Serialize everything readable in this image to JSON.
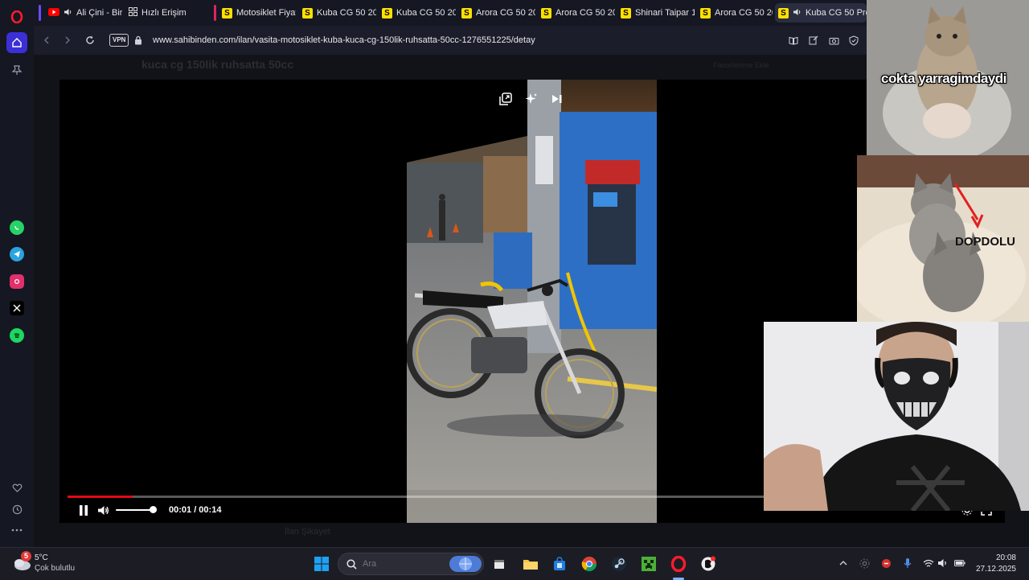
{
  "browser": {
    "tabs": [
      {
        "title": "Ali Çini - Birh",
        "favicon": "youtube-icon",
        "audio": true
      },
      {
        "title": "Hızlı Erişim",
        "favicon": "speed-dial-icon"
      },
      {
        "title": "Motosiklet Fiyatl",
        "favicon": "sahibinden-icon"
      },
      {
        "title": "Kuba CG 50 2024",
        "favicon": "sahibinden-icon"
      },
      {
        "title": "Kuba CG 50 2024",
        "favicon": "sahibinden-icon"
      },
      {
        "title": "Arora CG 50 202",
        "favicon": "sahibinden-icon"
      },
      {
        "title": "Arora CG 50 202",
        "favicon": "sahibinden-icon"
      },
      {
        "title": "Shinari Taipar 10",
        "favicon": "sahibinden-icon"
      },
      {
        "title": "Arora CG 50 202",
        "favicon": "sahibinden-icon"
      },
      {
        "title": "Kuba CG 50 Pro U",
        "favicon": "sahibinden-icon",
        "audio": true,
        "active": true
      }
    ],
    "url": "www.sahibinden.com/ilan/vasita-motosiklet-kuba-kuca-cg-150lik-ruhsatta-50cc-1276551225/detay",
    "url_host": "www.sahibinden.com",
    "url_path": "/ilan/vasita-motosiklet-kuba-kuca-cg-150lik-ruhsatta-50cc-1276551225/detay",
    "vpn_label": "VPN",
    "favicon_letter": "S",
    "accent_color": "#ffe000"
  },
  "sidebar": {
    "items": [
      "opera-logo-icon",
      "home-icon",
      "pinboard-icon",
      "whatsapp-icon",
      "telegram-icon",
      "instagram-icon",
      "x-icon",
      "spotify-icon",
      "heart-icon",
      "history-icon",
      "more-icon"
    ]
  },
  "page": {
    "title": "kuca cg 150lik ruhsatta 50cc",
    "crumb": "Favorilerime Ekle",
    "footer_note": "İlan Şikayet"
  },
  "player": {
    "time_current": "00:01",
    "time_total": "00:14",
    "time_label": "00:01 / 00:14",
    "progress": 0.07,
    "volume": 1.0,
    "state": "playing",
    "progress_color": "#e50914"
  },
  "overlays": {
    "meme_top_text": "cokta yarragimdaydi",
    "meme_mid_text": "DOPDOLU"
  },
  "taskbar": {
    "weather_temp": "5°C",
    "weather_desc": "Çok bulutlu",
    "weather_badge": "5",
    "search_placeholder": "Ara",
    "clock_time": "20:08",
    "clock_date": "27.12.2025"
  }
}
